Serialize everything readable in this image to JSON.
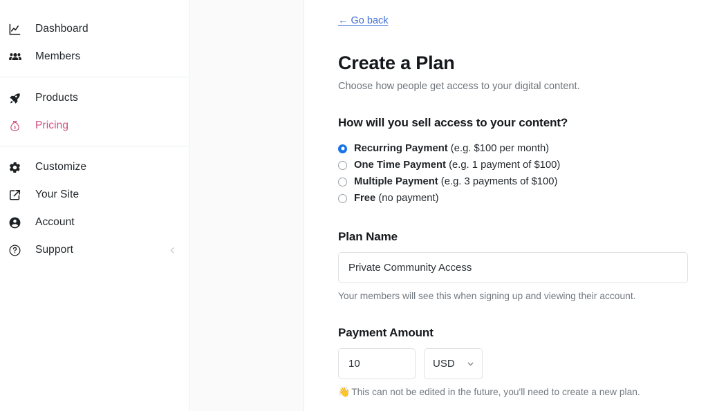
{
  "sidebar": {
    "groups": [
      {
        "items": [
          {
            "label": "Dashboard",
            "icon": "chart-line-icon",
            "active": false
          },
          {
            "label": "Members",
            "icon": "people-group-icon",
            "active": false
          }
        ]
      },
      {
        "items": [
          {
            "label": "Products",
            "icon": "rocket-icon",
            "active": false
          },
          {
            "label": "Pricing",
            "icon": "money-bag-icon",
            "active": true
          }
        ]
      },
      {
        "items": [
          {
            "label": "Customize",
            "icon": "gear-icon",
            "active": false
          },
          {
            "label": "Your Site",
            "icon": "external-link-icon",
            "active": false
          },
          {
            "label": "Account",
            "icon": "user-circle-icon",
            "active": false
          },
          {
            "label": "Support",
            "icon": "question-circle-icon",
            "active": false
          }
        ]
      }
    ],
    "collapse_icon": "chevron-left-icon",
    "active_color": "#d14b7e"
  },
  "content": {
    "go_back_label": "← Go back",
    "go_back_color": "#3f6fd8",
    "title": "Create a Plan",
    "subtitle": "Choose how people get access to your digital content.",
    "sell_question": "How will you sell access to your content?",
    "payment_options": [
      {
        "name": "Recurring Payment",
        "example": " (e.g. $100 per month)",
        "selected": true
      },
      {
        "name": "One Time Payment",
        "example": " (e.g. 1 payment of $100)",
        "selected": false
      },
      {
        "name": "Multiple Payment",
        "example": " (e.g. 3 payments of $100)",
        "selected": false
      },
      {
        "name": "Free",
        "example": " (no payment)",
        "selected": false
      }
    ],
    "selected_color": "#1a73e8",
    "plan_name": {
      "heading": "Plan Name",
      "value": "Private Community Access",
      "placeholder": "Plan name",
      "hint": "Your members will see this when signing up and viewing their account."
    },
    "payment_amount": {
      "heading": "Payment Amount",
      "value": "10",
      "placeholder": "0",
      "currency": "USD",
      "currency_icon": "chevron-down-icon",
      "hint_emoji": "👋",
      "hint": "This can not be edited in the future, you'll need to create a new plan."
    }
  }
}
